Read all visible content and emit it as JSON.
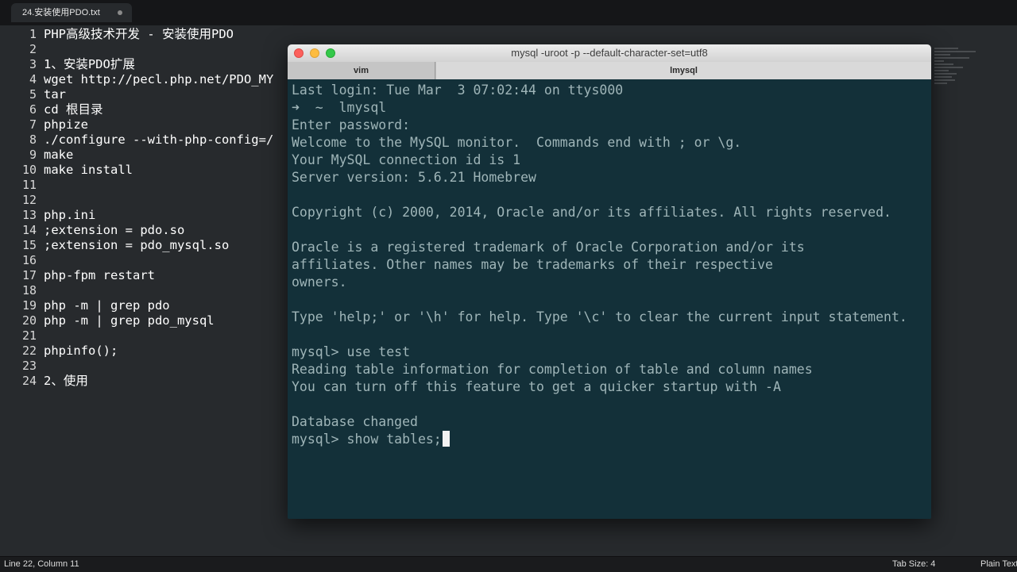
{
  "editor": {
    "tab_title": "24.安装使用PDO.txt",
    "lines": [
      "PHP高级技术开发 - 安装使用PDO",
      "",
      "1、安装PDO扩展",
      "wget http://pecl.php.net/PDO_MY",
      "tar",
      "cd 根目录",
      "phpize",
      "./configure --with-php-config=/",
      "make",
      "make install",
      "",
      "",
      "php.ini",
      ";extension = pdo.so",
      ";extension = pdo_mysql.so",
      "",
      "php-fpm restart",
      "",
      "php -m | grep pdo",
      "php -m | grep pdo_mysql",
      "",
      "phpinfo();",
      "",
      "2、使用"
    ],
    "line_numbers": [
      "1",
      "2",
      "3",
      "4",
      "5",
      "6",
      "7",
      "8",
      "9",
      "10",
      "11",
      "12",
      "13",
      "14",
      "15",
      "16",
      "17",
      "18",
      "19",
      "20",
      "21",
      "22",
      "23",
      "24"
    ]
  },
  "status_bar": {
    "position": "Line 22, Column 11",
    "tab_size": "Tab Size: 4",
    "syntax": "Plain Text"
  },
  "terminal": {
    "title": "mysql -uroot -p --default-character-set=utf8",
    "tabs": [
      "vim",
      "lmysql"
    ],
    "active_tab": "lmysql",
    "lines": [
      "Last login: Tue Mar  3 07:02:44 on ttys000",
      "➜  ~  lmysql",
      "Enter password:",
      "Welcome to the MySQL monitor.  Commands end with ; or \\g.",
      "Your MySQL connection id is 1",
      "Server version: 5.6.21 Homebrew",
      "",
      "Copyright (c) 2000, 2014, Oracle and/or its affiliates. All rights reserved.",
      "",
      "Oracle is a registered trademark of Oracle Corporation and/or its",
      "affiliates. Other names may be trademarks of their respective",
      "owners.",
      "",
      "Type 'help;' or '\\h' for help. Type '\\c' to clear the current input statement.",
      "",
      "mysql> use test",
      "Reading table information for completion of table and column names",
      "You can turn off this feature to get a quicker startup with -A",
      "",
      "Database changed"
    ],
    "prompt_line": "mysql> show tables;",
    "colors": {
      "background": "#133039",
      "text": "#9fb5b8",
      "cursor": "#f2f2f2"
    }
  },
  "colors": {
    "editor_background": "#272a2d",
    "editor_text": "#ffffff"
  }
}
